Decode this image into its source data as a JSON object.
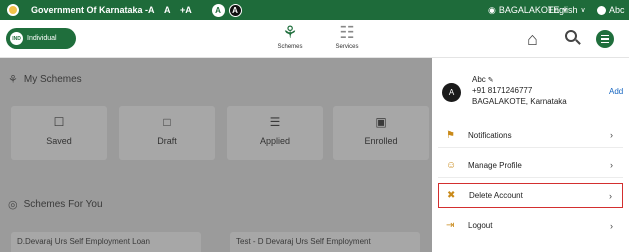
{
  "topbar": {
    "title": "Government Of Karnataka",
    "font_small": "-A",
    "font_normal": "A",
    "font_large": "+A",
    "contrast_light": "A",
    "contrast_dark": "A",
    "location": "BAGALAKOTE",
    "language": "English",
    "user": "Abc"
  },
  "header": {
    "profile_pill": "Individual",
    "nav": [
      {
        "label": "Schemes",
        "icon": "schemes-icon"
      },
      {
        "label": "Services",
        "icon": "services-icon"
      }
    ]
  },
  "main": {
    "my_schemes_title": "My Schemes",
    "cards": [
      {
        "label": "Saved",
        "icon": "saved-icon"
      },
      {
        "label": "Draft",
        "icon": "draft-icon"
      },
      {
        "label": "Applied",
        "icon": "applied-icon"
      },
      {
        "label": "Enrolled",
        "icon": "enrolled-icon"
      }
    ],
    "schemes_for_you_title": "Schemes For You",
    "scheme_cards": [
      "D.Devaraj Urs Self Employment Loan",
      "Test - D Devaraj Urs Self Employment"
    ]
  },
  "panel": {
    "avatar_letter": "A",
    "name": "Abc",
    "phone": "+91 8171246777",
    "location": "BAGALAKOTE, Karnataka",
    "add_label": "Add",
    "menu": [
      {
        "label": "Notifications",
        "icon": "bell-icon"
      },
      {
        "label": "Manage Profile",
        "icon": "profile-icon"
      },
      {
        "label": "Delete Account",
        "icon": "delete-account-icon",
        "highlighted": true
      },
      {
        "label": "Logout",
        "icon": "logout-icon"
      }
    ]
  },
  "colors": {
    "brand_green": "#1f6e3c",
    "topbar_green": "#1e6b3a",
    "highlight_red": "#d32f2f",
    "link_blue": "#1565c0",
    "overlay_gray": "#9b9b9b"
  }
}
